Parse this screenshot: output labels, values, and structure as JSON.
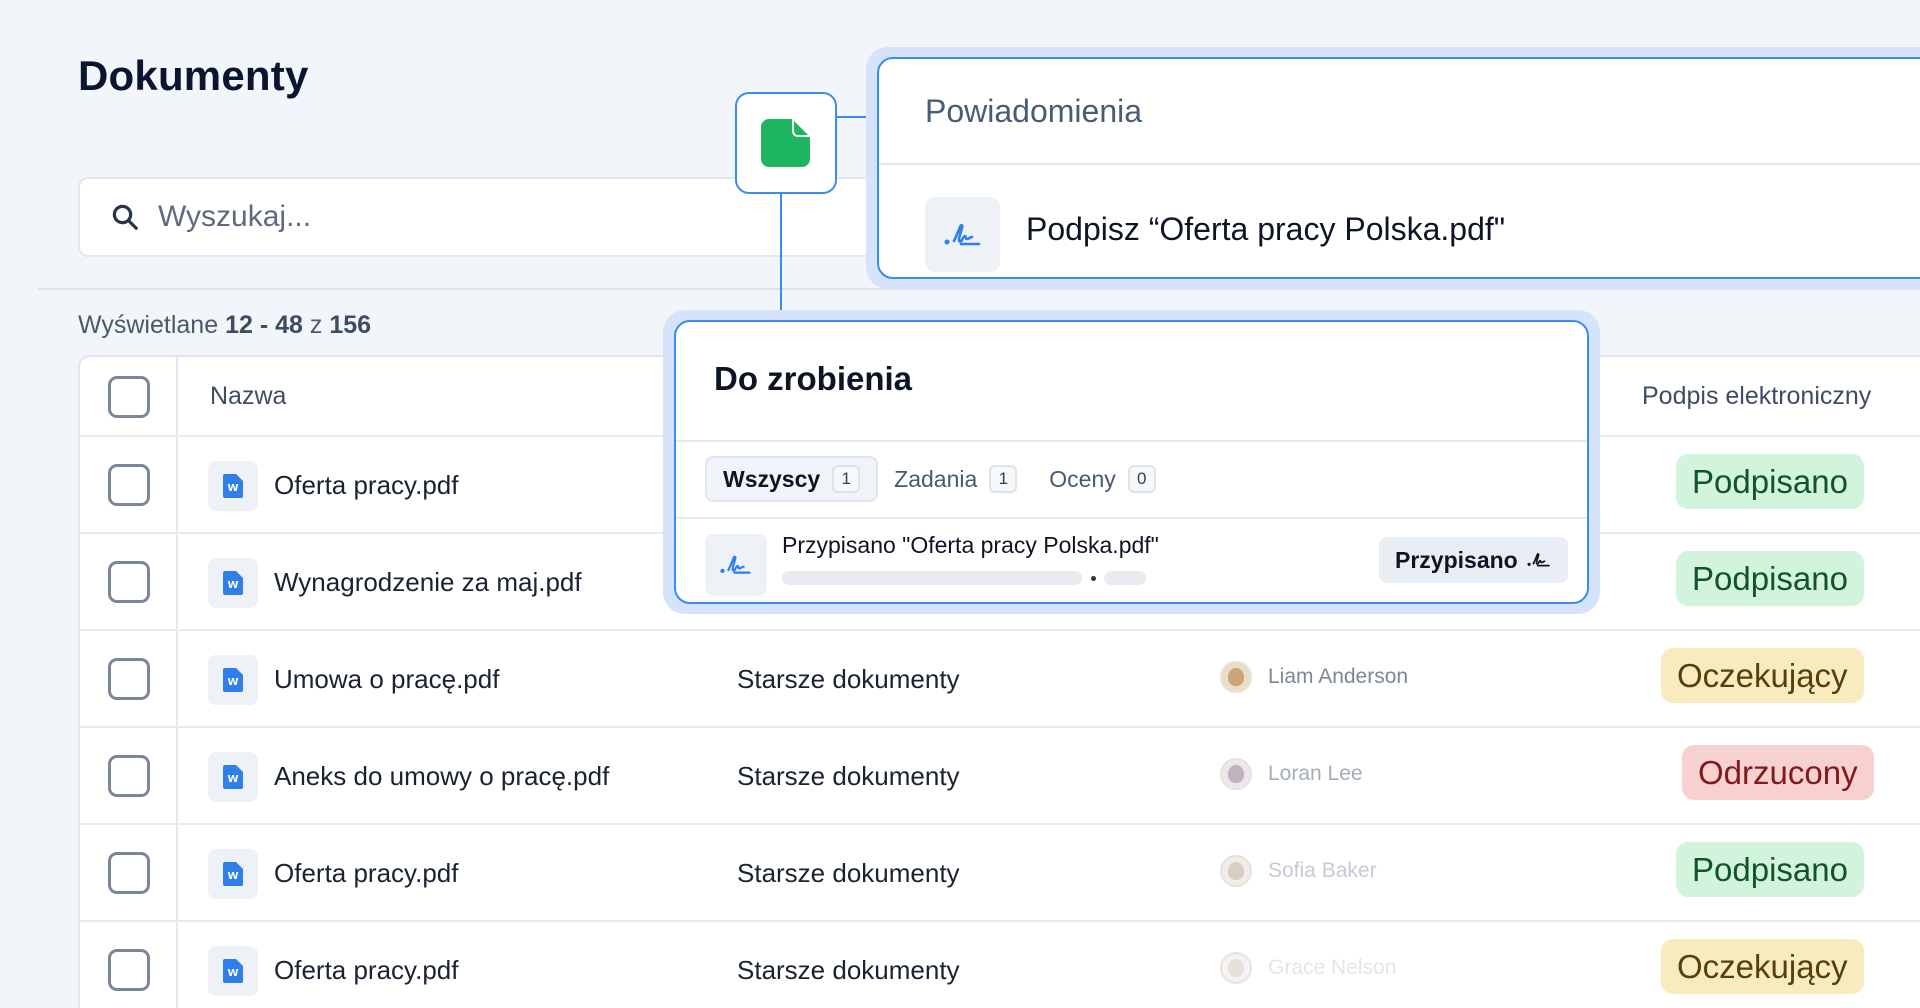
{
  "page": {
    "title": "Dokumenty"
  },
  "search": {
    "placeholder": "Wyszukaj...",
    "icon": "search-icon"
  },
  "listing": {
    "prefix": "Wyświetlane",
    "range": "12 - 48",
    "of": "z",
    "total": "156"
  },
  "table": {
    "columns": {
      "name": "Nazwa",
      "signature": "Podpis elektroniczny"
    },
    "rows": [
      {
        "file": "Oferta pracy.pdf",
        "folder": "",
        "person": "",
        "status": "Podpisano",
        "status_color": "#d3f4dc"
      },
      {
        "file": "Wynagrodzenie za maj.pdf",
        "folder": "",
        "person": "",
        "status": "Podpisano",
        "status_color": "#d3f4dc"
      },
      {
        "file": "Umowa o pracę.pdf",
        "folder": "Starsze dokumenty",
        "person": "Liam Anderson",
        "status": "Oczekujący",
        "status_color": "#f8ebbd"
      },
      {
        "file": "Aneks do umowy o pracę.pdf",
        "folder": "Starsze dokumenty",
        "person": "Loran Lee",
        "status": "Odrzucony",
        "status_color": "#f7d0d0"
      },
      {
        "file": "Oferta pracy.pdf",
        "folder": "Starsze dokumenty",
        "person": "Sofia Baker",
        "status": "Podpisano",
        "status_color": "#d3f4dc"
      },
      {
        "file": "Oferta pracy.pdf",
        "folder": "Starsze dokumenty",
        "person": "Grace Nelson",
        "status": "Oczekujący",
        "status_color": "#f8ebbd"
      }
    ]
  },
  "notification": {
    "title": "Powiadomienia",
    "message": "Podpisz “Oferta pracy Polska.pdf\"",
    "icon": "signature-icon"
  },
  "todo": {
    "title": "Do zrobienia",
    "tabs": [
      {
        "label": "Wszyscy",
        "count": "1"
      },
      {
        "label": "Zadania",
        "count": "1"
      },
      {
        "label": "Oceny",
        "count": "0"
      }
    ],
    "task": {
      "text": "Przypisano \"Oferta pracy Polska.pdf\"",
      "status": "Przypisano"
    }
  },
  "colors": {
    "accent": "#3a8cf0",
    "doc_green": "#1db560",
    "file_blue": "#2f7fe8"
  }
}
